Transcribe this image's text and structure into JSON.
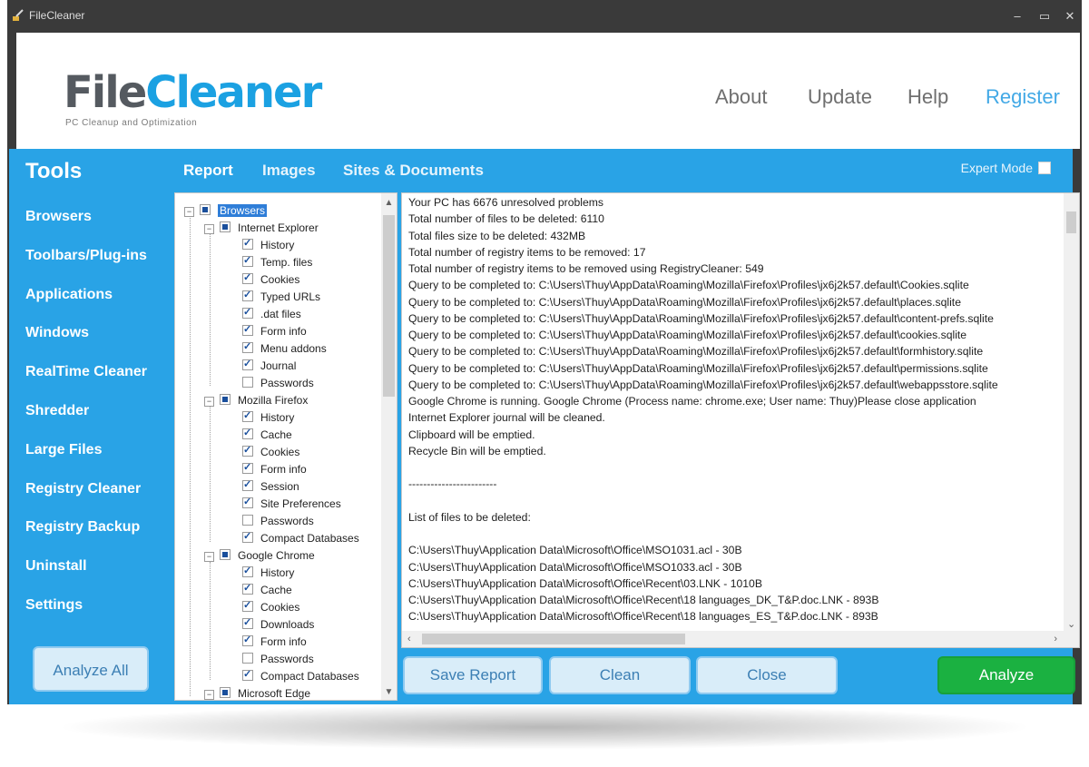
{
  "window": {
    "title": "FileCleaner",
    "controls": [
      "–",
      "▭",
      "✕"
    ]
  },
  "header": {
    "logo_file": "File",
    "logo_cleaner": "Cleaner",
    "logo_tagline": "PC Cleanup and Optimization",
    "nav": [
      "About",
      "Update",
      "Help",
      "Register"
    ],
    "accent": "#1ba1e2"
  },
  "toolbar": {
    "tools_title": "Tools",
    "tabs": [
      "Report",
      "Images",
      "Sites & Documents"
    ],
    "expert_mode": "Expert Mode"
  },
  "sidebar": {
    "items": [
      "Browsers",
      "Toolbars/Plug-ins",
      "Applications",
      "Windows",
      "RealTime Cleaner",
      "Shredder",
      "Large Files",
      "Registry Cleaner",
      "Registry Backup",
      "Uninstall",
      "Settings"
    ],
    "analyze_all": "Analyze All"
  },
  "tree": {
    "root": "Browsers",
    "ie": "Internet Explorer",
    "ie_items": [
      "History",
      "Temp. files",
      "Cookies",
      "Typed URLs",
      ".dat files",
      "Form info",
      "Menu addons",
      "Journal",
      "Passwords"
    ],
    "ff": "Mozilla Firefox",
    "ff_items": [
      "History",
      "Cache",
      "Cookies",
      "Form info",
      "Session",
      "Site Preferences",
      "Passwords",
      "Compact Databases"
    ],
    "gc": "Google Chrome",
    "gc_items": [
      "History",
      "Cache",
      "Cookies",
      "Downloads",
      "Form info",
      "Passwords",
      "Compact Databases"
    ],
    "edge": "Microsoft Edge"
  },
  "report": {
    "lines": [
      "Your PC has 6676 unresolved problems",
      "Total number of files to be deleted: 6110",
      "Total files size to be deleted: 432MB",
      "Total number of registry items to be removed: 17",
      "Total number of registry items to be removed using RegistryCleaner: 549",
      "Query to be completed to: C:\\Users\\Thuy\\AppData\\Roaming\\Mozilla\\Firefox\\Profiles\\jx6j2k57.default\\Cookies.sqlite",
      "Query to be completed to: C:\\Users\\Thuy\\AppData\\Roaming\\Mozilla\\Firefox\\Profiles\\jx6j2k57.default\\places.sqlite",
      "Query to be completed to: C:\\Users\\Thuy\\AppData\\Roaming\\Mozilla\\Firefox\\Profiles\\jx6j2k57.default\\content-prefs.sqlite",
      "Query to be completed to: C:\\Users\\Thuy\\AppData\\Roaming\\Mozilla\\Firefox\\Profiles\\jx6j2k57.default\\cookies.sqlite",
      "Query to be completed to: C:\\Users\\Thuy\\AppData\\Roaming\\Mozilla\\Firefox\\Profiles\\jx6j2k57.default\\formhistory.sqlite",
      "Query to be completed to: C:\\Users\\Thuy\\AppData\\Roaming\\Mozilla\\Firefox\\Profiles\\jx6j2k57.default\\permissions.sqlite",
      "Query to be completed to: C:\\Users\\Thuy\\AppData\\Roaming\\Mozilla\\Firefox\\Profiles\\jx6j2k57.default\\webappsstore.sqlite",
      "Google Chrome is running. Google Chrome (Process name: chrome.exe; User name: Thuy)Please close application",
      "Internet Explorer journal will be cleaned.",
      "Clipboard will be emptied.",
      "Recycle Bin will be emptied.",
      "",
      "------------------------",
      "",
      "List of files to be deleted:",
      "",
      "C:\\Users\\Thuy\\Application Data\\Microsoft\\Office\\MSO1031.acl - 30B",
      "C:\\Users\\Thuy\\Application Data\\Microsoft\\Office\\MSO1033.acl - 30B",
      "C:\\Users\\Thuy\\Application Data\\Microsoft\\Office\\Recent\\03.LNK - 1010B",
      "C:\\Users\\Thuy\\Application Data\\Microsoft\\Office\\Recent\\18 languages_DK_T&P.doc.LNK - 893B",
      "C:\\Users\\Thuy\\Application Data\\Microsoft\\Office\\Recent\\18 languages_ES_T&P.doc.LNK - 893B"
    ]
  },
  "buttons": {
    "save_report": "Save Report",
    "clean": "Clean",
    "close": "Close",
    "analyze": "Analyze"
  }
}
